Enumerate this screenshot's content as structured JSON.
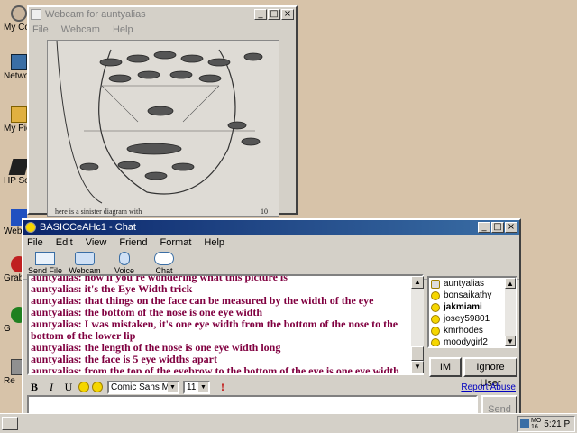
{
  "desktop": {
    "icons": [
      {
        "label": "My Computer",
        "icon": "computer-icon",
        "color": "#5a5a5a"
      },
      {
        "label": "Network Neighborhood",
        "icon": "network-icon",
        "color": "#3a6ea5"
      },
      {
        "label": "My Pictures",
        "icon": "folder-icon",
        "color": "#c08000"
      },
      {
        "label": "HP Software",
        "icon": "software-icon",
        "color": "#202020"
      },
      {
        "label": "Web",
        "icon": "web-icon",
        "color": "#2050c0"
      },
      {
        "label": "Grab",
        "icon": "grab-icon",
        "color": "#c02020"
      },
      {
        "label": "G",
        "icon": "app-icon",
        "color": "#208020"
      },
      {
        "label": "Re",
        "icon": "recycle-icon",
        "color": "#606060"
      }
    ]
  },
  "webcam_window": {
    "title": "Webcam for auntyalias",
    "menu": [
      "File",
      "Webcam",
      "Help"
    ],
    "image_caption": "here is a sinister diagram with",
    "page_number": "10"
  },
  "chat_window": {
    "title": "BASICCeAHc1 - Chat",
    "menu": [
      "File",
      "Edit",
      "View",
      "Friend",
      "Format",
      "Help"
    ],
    "toolbar": [
      {
        "label": "Send File",
        "icon": "send-file-icon"
      },
      {
        "label": "Webcam",
        "icon": "webcam-icon"
      },
      {
        "label": "Voice",
        "icon": "voice-icon"
      },
      {
        "label": "Chat",
        "icon": "chat-icon"
      }
    ],
    "messages": [
      "auntyalias: now if you're wondering what this picture is",
      "auntyalias: it's the Eye Width trick",
      "auntyalias: that things on the face can be measured by the width of the eye",
      "auntyalias: the bottom of the nose is one eye width",
      "auntyalias: I was mistaken, it's one eye width from the bottom of the nose to the bottom of the lower lip",
      "auntyalias: the length of the nose is one eye width long",
      "auntyalias: the face is 5 eye widths apart",
      "auntyalias: from the top of the eyebrow to the bottom of the eye is one eye width"
    ],
    "users": [
      {
        "name": "auntyalias",
        "bold": false
      },
      {
        "name": "bonsaikathy",
        "bold": false
      },
      {
        "name": "jakmiami",
        "bold": true
      },
      {
        "name": "josey59801",
        "bold": false
      },
      {
        "name": "kmrhodes",
        "bold": false
      },
      {
        "name": "moodygirl2",
        "bold": false
      }
    ],
    "im_button": "IM",
    "ignore_button": "Ignore User",
    "format": {
      "font": "Comic Sans MS",
      "size": "11"
    },
    "report_abuse": "Report Abuse",
    "send_button": "Send",
    "message_color": "#800040",
    "title_color": "#0a246a"
  },
  "taskbar": {
    "day": "MO",
    "date": "16",
    "time": "5:21 P"
  }
}
